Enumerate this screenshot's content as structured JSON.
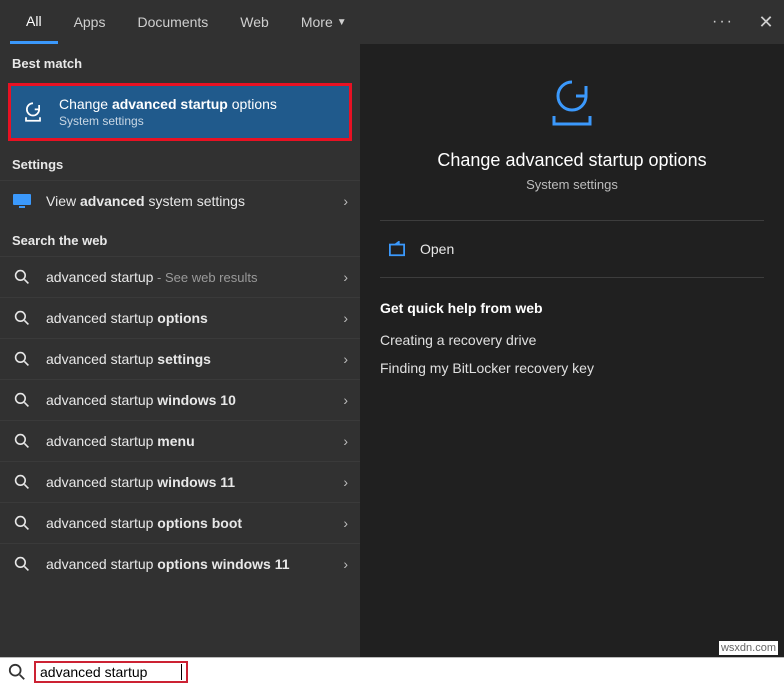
{
  "tabs": {
    "all": "All",
    "apps": "Apps",
    "documents": "Documents",
    "web": "Web",
    "more": "More"
  },
  "sections": {
    "best_match": "Best match",
    "settings": "Settings",
    "search_web": "Search the web"
  },
  "best_match_item": {
    "pre": "Change ",
    "bold": "advanced startup",
    "post": " options",
    "sub": "System settings"
  },
  "settings_row": {
    "pre": "View ",
    "bold": "advanced",
    "post": " system settings"
  },
  "web_results": [
    {
      "plain": "advanced startup",
      "bold": "",
      "muted": " - See web results"
    },
    {
      "plain": "advanced startup ",
      "bold": "options",
      "muted": ""
    },
    {
      "plain": "advanced startup ",
      "bold": "settings",
      "muted": ""
    },
    {
      "plain": "advanced startup ",
      "bold": "windows 10",
      "muted": ""
    },
    {
      "plain": "advanced startup ",
      "bold": "menu",
      "muted": ""
    },
    {
      "plain": "advanced startup ",
      "bold": "windows 11",
      "muted": ""
    },
    {
      "plain": "advanced startup ",
      "bold": "options boot",
      "muted": ""
    },
    {
      "plain": "advanced startup ",
      "bold": "options windows 11",
      "muted": ""
    }
  ],
  "preview": {
    "title": "Change advanced startup options",
    "sub": "System settings",
    "open": "Open",
    "help_header": "Get quick help from web",
    "help_links": [
      "Creating a recovery drive",
      "Finding my BitLocker recovery key"
    ]
  },
  "search": {
    "value": "advanced startup"
  },
  "watermark": "wsxdn.com",
  "colors": {
    "accent": "#3b99fc",
    "highlight_red": "#e81123",
    "selected_bg": "#205a8c"
  }
}
